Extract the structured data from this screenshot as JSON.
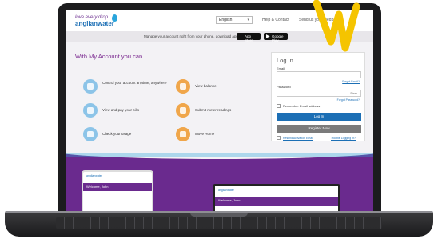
{
  "logo": {
    "line1": "love every drop",
    "line2": "anglianwater"
  },
  "header": {
    "language": "English",
    "help_link": "Help & Contact",
    "feedback_link": "Send us your feedback"
  },
  "strip": {
    "text": "Manage your account right from your phone, download app",
    "app_store": "App Store",
    "google_play": "Google Play"
  },
  "main": {
    "title": "With My Account you can",
    "features": [
      {
        "label": "Control your account anytime, anywhere",
        "icon": "phone-icon"
      },
      {
        "label": "View balance",
        "icon": "balance-icon"
      },
      {
        "label": "View and pay your bills",
        "icon": "bill-icon"
      },
      {
        "label": "Submit meter readings",
        "icon": "meter-icon"
      },
      {
        "label": "Check your usage",
        "icon": "usage-chart-icon"
      },
      {
        "label": "Move Home",
        "icon": "van-icon"
      }
    ]
  },
  "login": {
    "title": "Log In",
    "email_label": "Email",
    "forgot_email": "Forgot Email?",
    "password_label": "Password",
    "show": "Show",
    "forgot_password": "Forgot Password?",
    "remember": "Remember Email address",
    "login_button": "Log In",
    "register_button": "Register Now",
    "resend": "Resend Activation Email",
    "trouble": "Trouble Logging In?"
  },
  "devices": {
    "tablet_title": "Welcome, John",
    "monitor_title": "Welcome, John"
  },
  "colors": {
    "brand_purple": "#6a2a8e",
    "brand_blue": "#1c6fb5",
    "accent_yellow": "#f5c400"
  }
}
